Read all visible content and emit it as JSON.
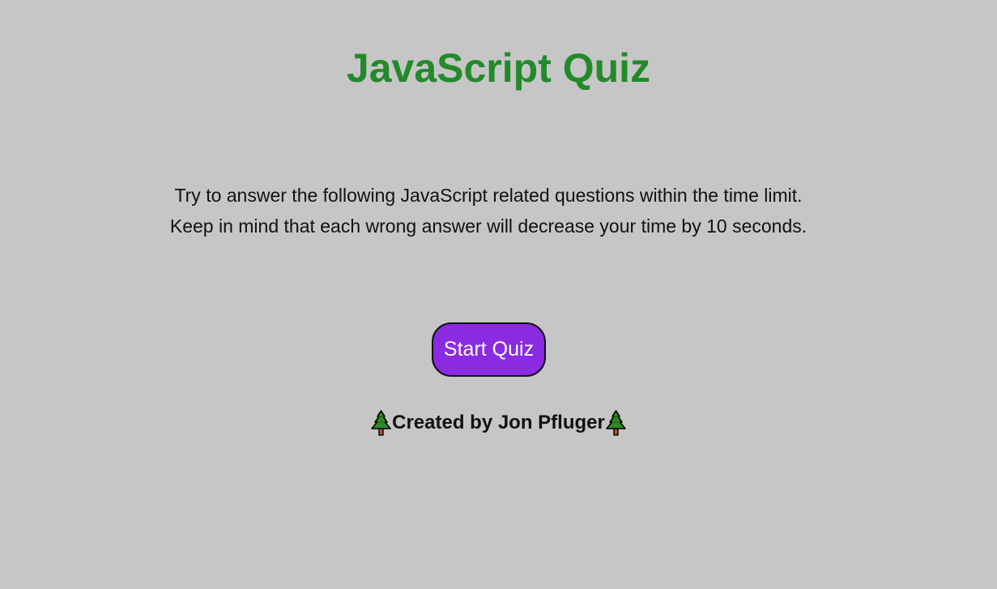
{
  "page": {
    "title": "JavaScript Quiz",
    "intro": "Try to answer the following JavaScript related questions within the time limit. Keep in mind that each wrong answer will decrease your time by 10 seconds.",
    "start_button_label": "Start Quiz",
    "footer_text": "Created by Jon Pfluger",
    "footer_icons": [
      "tree-icon",
      "tree-icon"
    ]
  },
  "colors": {
    "background": "#c6c6c6",
    "title": "#238a2a",
    "button": "#8a2be2",
    "button_text": "#ffffff"
  }
}
